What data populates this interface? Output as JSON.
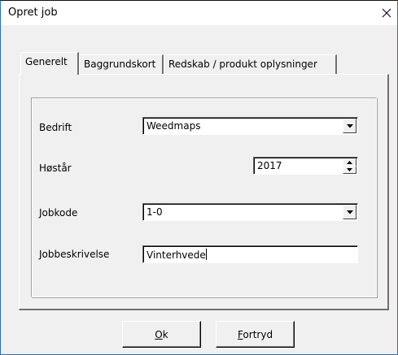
{
  "window": {
    "title": "Opret job",
    "close_glyph": "×"
  },
  "tabs": [
    {
      "label": "Generelt",
      "active": true
    },
    {
      "label": "Baggrundskort",
      "active": false
    },
    {
      "label": "Redskab / produkt oplysninger",
      "active": false
    }
  ],
  "form": {
    "bedrift": {
      "label": "Bedrift",
      "value": "Weedmaps"
    },
    "hoestaar": {
      "label": "Høstår",
      "value": "2017"
    },
    "jobkode": {
      "label": "Jobkode",
      "value": "1-0"
    },
    "jobbeskrivelse": {
      "label": "Jobbeskrivelse",
      "value": "Vinterhvede"
    }
  },
  "buttons": {
    "ok": {
      "mnemonic": "O",
      "rest": "k"
    },
    "cancel": {
      "mnemonic": "F",
      "rest": "ortryd"
    }
  },
  "icons": {
    "dropdown": "triangle-down-icon",
    "spin_up": "triangle-up-icon",
    "spin_down": "triangle-down-icon",
    "close": "close-icon"
  }
}
